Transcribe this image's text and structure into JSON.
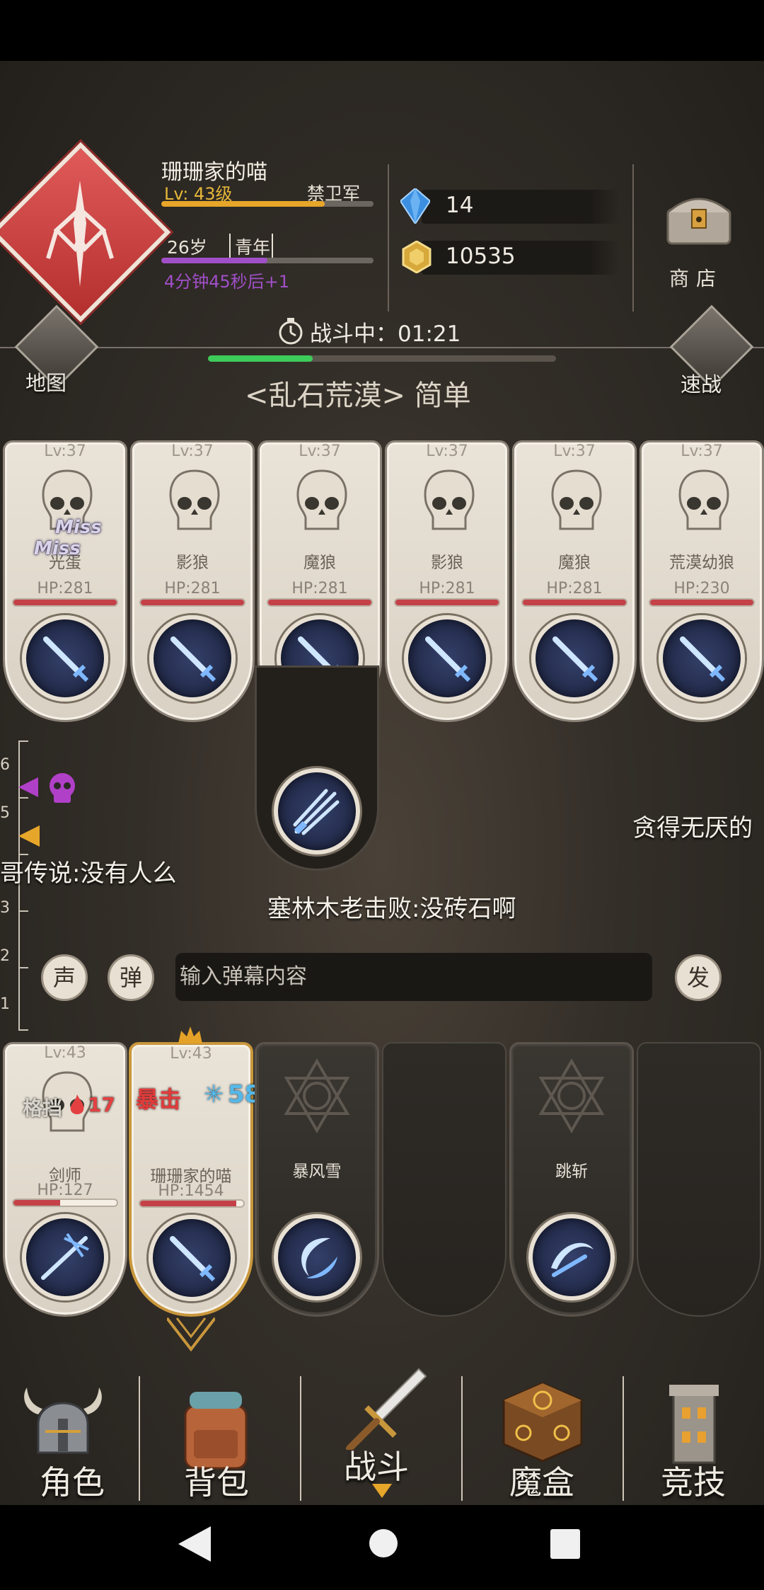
{
  "player": {
    "name": "珊珊家的喵",
    "level_text": "Lv: 43级",
    "rank": "禁卫军",
    "level_progress": 0.77,
    "age": "26岁",
    "life_stage": "青年",
    "age_progress": 0.5,
    "age_timer": "4分钟45秒后+1"
  },
  "currency": {
    "gems": "14",
    "gold": "10535"
  },
  "shop_label": "商店",
  "map_label": "地图",
  "quick_battle_label": "速战",
  "battle": {
    "status": "战斗中：01:21",
    "progress": 0.3,
    "zone": "<乱石荒漠> 简单"
  },
  "enemies": [
    {
      "level": "Lv:37",
      "name": "光蛋",
      "hp": "HP:281",
      "hp_ratio": 1.0
    },
    {
      "level": "Lv:37",
      "name": "影狼",
      "hp": "HP:281",
      "hp_ratio": 1.0
    },
    {
      "level": "Lv:37",
      "name": "魔狼",
      "hp": "HP:281",
      "hp_ratio": 1.0
    },
    {
      "level": "Lv:37",
      "name": "影狼",
      "hp": "HP:281",
      "hp_ratio": 1.0
    },
    {
      "level": "Lv:37",
      "name": "魔狼",
      "hp": "HP:281",
      "hp_ratio": 1.0
    },
    {
      "level": "Lv:37",
      "name": "荒漠幼狼",
      "hp": "HP:230",
      "hp_ratio": 1.0
    }
  ],
  "miss_texts": [
    "Miss",
    "Miss"
  ],
  "danmaku": [
    "贪得无厌的",
    "哥传说:没有人么",
    "塞林木老击败:没砖石啊"
  ],
  "round_numbers": [
    "6",
    "5",
    "3",
    "2",
    "1"
  ],
  "controls": {
    "sound_label": "声",
    "danmaku_label": "弹",
    "input_placeholder": "输入弹幕内容",
    "send_label": "发"
  },
  "party": [
    {
      "level": "Lv:43",
      "name": "剑师",
      "hp": "HP:127",
      "hp_ratio": 0.45
    },
    {
      "level": "Lv:43",
      "name": "珊珊家的喵",
      "hp": "HP:1454",
      "hp_ratio": 0.93
    }
  ],
  "skills": [
    {
      "name": "暴风雪"
    },
    {
      "name": "跳斩"
    }
  ],
  "combat_text": {
    "parry": "格挡",
    "parry_damage": "17",
    "crit": "暴击",
    "crit_value": "58"
  },
  "tabs": [
    {
      "label": "角色",
      "icon": "helmet-icon"
    },
    {
      "label": "背包",
      "icon": "backpack-icon"
    },
    {
      "label": "战斗",
      "icon": "sword-icon"
    },
    {
      "label": "魔盒",
      "icon": "magic-box-icon"
    },
    {
      "label": "竞技",
      "icon": "tower-icon"
    }
  ],
  "colors": {
    "level_bar": "#e7a62a",
    "age_bar": "#a04fc8",
    "battle_progress": "#3dcb5a",
    "hp_bar": "#c44148",
    "emblem": "#c8383a"
  }
}
